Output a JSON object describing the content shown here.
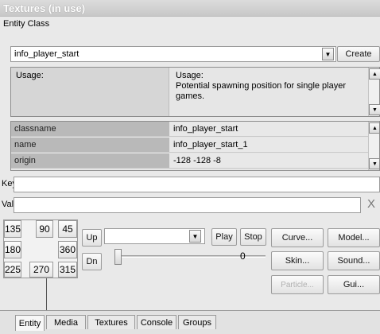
{
  "window": {
    "title": "Textures (in use)"
  },
  "entity_class": {
    "label": "Entity Class",
    "selected": "info_player_start",
    "create_label": "Create"
  },
  "usage": {
    "left_label": "Usage:",
    "right_title": "Usage:",
    "right_text": "Potential spawning position for single player games."
  },
  "properties": [
    {
      "key": "classname",
      "value": "info_player_start"
    },
    {
      "key": "name",
      "value": "info_player_start_1"
    },
    {
      "key": "origin",
      "value": "-128 -128 -8"
    }
  ],
  "key_field": {
    "label": "Key",
    "value": ""
  },
  "val_field": {
    "label": "Val",
    "value": "",
    "clear_label": "X"
  },
  "angles": [
    "135",
    "90",
    "45",
    "180",
    "360",
    "225",
    "270",
    "315"
  ],
  "controls": {
    "up_label": "Up",
    "dn_label": "Dn",
    "play_label": "Play",
    "stop_label": "Stop",
    "slider_value": "0",
    "combo_value": ""
  },
  "buttons": {
    "curve": "Curve...",
    "model": "Model...",
    "skin": "Skin...",
    "sound": "Sound...",
    "particle": "Particle...",
    "gui": "Gui..."
  },
  "tabs": [
    "Entity",
    "Media",
    "Textures",
    "Console",
    "Groups"
  ],
  "colors": {
    "background": "#e9e9e9",
    "property_key_bg": "#b9b9b9"
  }
}
